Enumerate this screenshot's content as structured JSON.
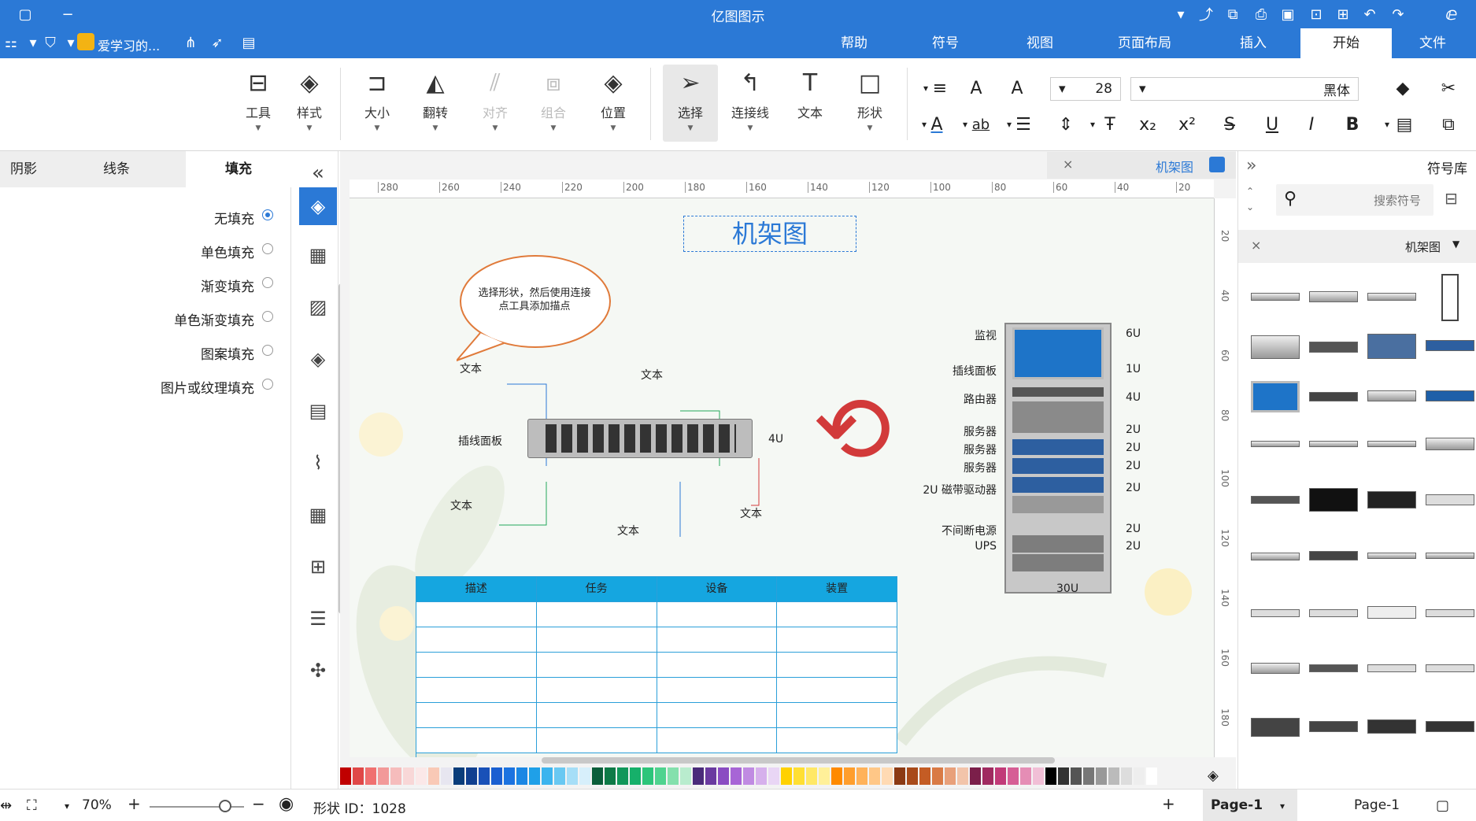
{
  "titlebar": {
    "title": "亿图图示"
  },
  "quickbar": {
    "item_label": "爱学习的..."
  },
  "menu": {
    "tabs": [
      "文件",
      "开始",
      "插入",
      "页面布局",
      "视图",
      "符号",
      "帮助"
    ],
    "active": "开始"
  },
  "ribbon": {
    "font_name": "黑体",
    "font_size": "28",
    "buttons": {
      "shape": "形状",
      "text": "文本",
      "connector": "连接线",
      "select": "选择",
      "position": "位置",
      "group": "组合",
      "align": "对齐",
      "flip": "翻转",
      "size": "大小",
      "style": "样式",
      "tools": "工具"
    }
  },
  "left_panel": {
    "tabs": [
      "填充",
      "线条",
      "阴影"
    ],
    "active_tab": "填充",
    "fill_options": [
      "无填充",
      "单色填充",
      "渐变填充",
      "单色渐变填充",
      "图案填充",
      "图片或纹理填充"
    ],
    "selected_fill": "无填充"
  },
  "document": {
    "tab_title": "机架图"
  },
  "ruler": {
    "h_ticks": [
      "20",
      "40",
      "60",
      "80",
      "100",
      "120",
      "140",
      "160",
      "180",
      "200",
      "220",
      "240",
      "260",
      "280"
    ],
    "v_ticks": [
      "20",
      "40",
      "60",
      "80",
      "100",
      "120",
      "140",
      "160",
      "180"
    ]
  },
  "canvas": {
    "title": "机架图",
    "callout_text": "选择形状，然后使用连接点工具添加描点",
    "patch_panel": {
      "label": "插线面板",
      "units": "4U",
      "text_labels": [
        "文本",
        "文本",
        "文本",
        "文本",
        "文本"
      ]
    },
    "rack": {
      "total_units": "30U",
      "devices": [
        {
          "label": "监视",
          "units": "6U"
        },
        {
          "label": "插线面板",
          "units": "1U"
        },
        {
          "label": "路由器",
          "units": "4U"
        },
        {
          "label": "服务器",
          "units": "2U"
        },
        {
          "label": "服务器",
          "units": "2U"
        },
        {
          "label": "服务器",
          "units": "2U"
        },
        {
          "label": "2U 磁带驱动器",
          "units": "2U"
        },
        {
          "label": "不间断电源",
          "units": "2U"
        },
        {
          "label": "UPS",
          "units": "2U"
        }
      ]
    },
    "table": {
      "headers": [
        "装置",
        "设备",
        "任务",
        "描述"
      ],
      "rows": 6
    }
  },
  "right_panel": {
    "title": "符号库",
    "search_placeholder": "搜索符号",
    "library": "机架图"
  },
  "statusbar": {
    "page_selector": "Page-1",
    "page_tab": "Page-1",
    "shape_id": "形状 ID：1028",
    "zoom": "70%"
  },
  "colors": {
    "accent": "#2b79d6",
    "table_header": "#15a6e0",
    "refresh_red": "#d23a3a"
  },
  "palette_colors": [
    "#c00000",
    "#e04848",
    "#f07070",
    "#f29999",
    "#f6bcbc",
    "#f8d7d7",
    "#fbe8e8",
    "#f9c9b6",
    "#e7e6f0",
    "#0a3d7a",
    "#103f8f",
    "#1951b8",
    "#1a5fd1",
    "#1c73e0",
    "#1b87e4",
    "#1fa0e8",
    "#3cb4ee",
    "#69c8f2",
    "#a6def7",
    "#d7effb",
    "#0b5e3a",
    "#0e7a47",
    "#11975a",
    "#16b06a",
    "#2cc57a",
    "#4fd38f",
    "#84e0ad",
    "#b9ecce",
    "#4a2b7a",
    "#6a3aa0",
    "#8a4cc2",
    "#a765d6",
    "#c08be2",
    "#d6b0ec",
    "#e9d6f5",
    "#ffd100",
    "#ffdf33",
    "#ffe866",
    "#fff099",
    "#ff8a00",
    "#ff9e2d",
    "#ffb25a",
    "#ffc787",
    "#ffdab3",
    "#8b3a14",
    "#a84a1a",
    "#c45c24",
    "#d97a45",
    "#e8a07a",
    "#f2c4aa",
    "#7b1f4a",
    "#a02a60",
    "#c13a78",
    "#d65e95",
    "#e58db5",
    "#f1bfd6",
    "#000000",
    "#333333",
    "#555555",
    "#777777",
    "#999999",
    "#bbbbbb",
    "#dddddd",
    "#eeeeee",
    "#ffffff"
  ]
}
